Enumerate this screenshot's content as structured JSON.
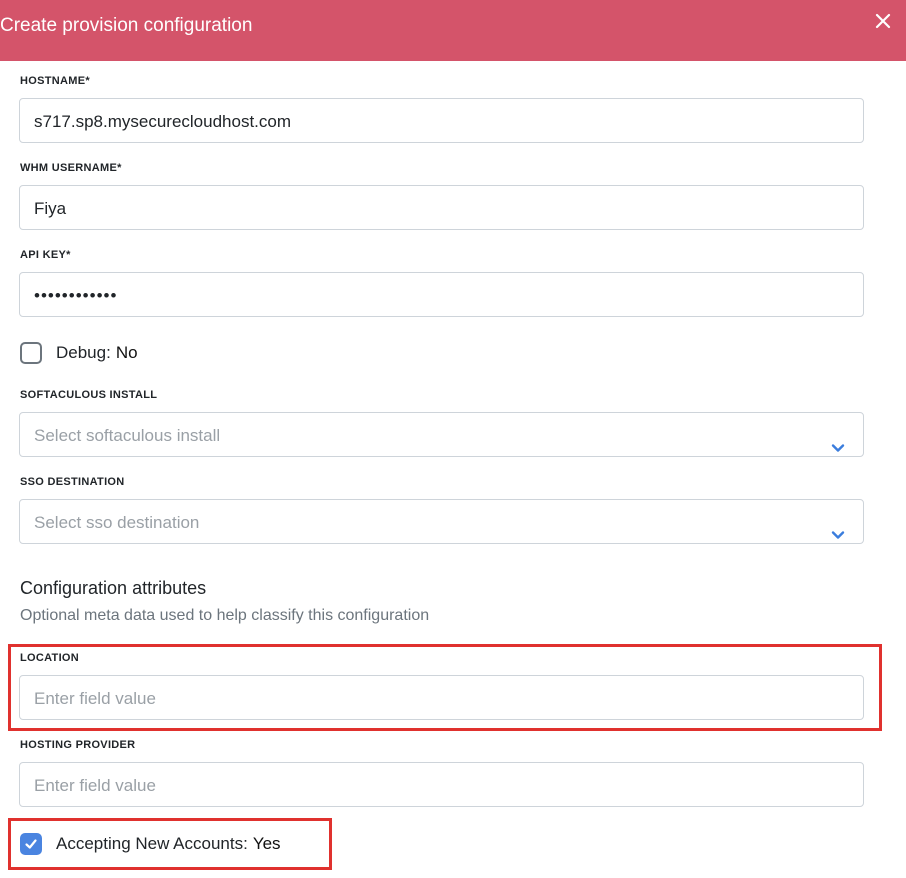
{
  "header": {
    "title": "Create provision configuration",
    "close_icon": "close-icon"
  },
  "fields": {
    "hostname": {
      "label": "HOSTNAME*",
      "value": "s717.sp8.mysecurecloudhost.com"
    },
    "whm_username": {
      "label": "WHM USERNAME*",
      "value": "Fiya"
    },
    "api_key": {
      "label": "API KEY*",
      "value": "••••••••••••"
    },
    "debug": {
      "label": "Debug:",
      "value": "No",
      "checked": false
    },
    "softaculous": {
      "label": "SOFTACULOUS INSTALL",
      "placeholder": "Select softaculous install"
    },
    "sso_destination": {
      "label": "SSO DESTINATION",
      "placeholder": "Select sso destination"
    }
  },
  "attributes": {
    "title": "Configuration attributes",
    "subtitle": "Optional meta data used to help classify this configuration",
    "location": {
      "label": "LOCATION",
      "placeholder": "Enter field value"
    },
    "hosting_provider": {
      "label": "HOSTING PROVIDER",
      "placeholder": "Enter field value"
    },
    "accepting": {
      "label": "Accepting New Accounts:",
      "value": "Yes",
      "checked": true
    }
  },
  "colors": {
    "header": "#d4546a",
    "highlight": "#e0312e",
    "checkbox_checked": "#4a84e0"
  }
}
